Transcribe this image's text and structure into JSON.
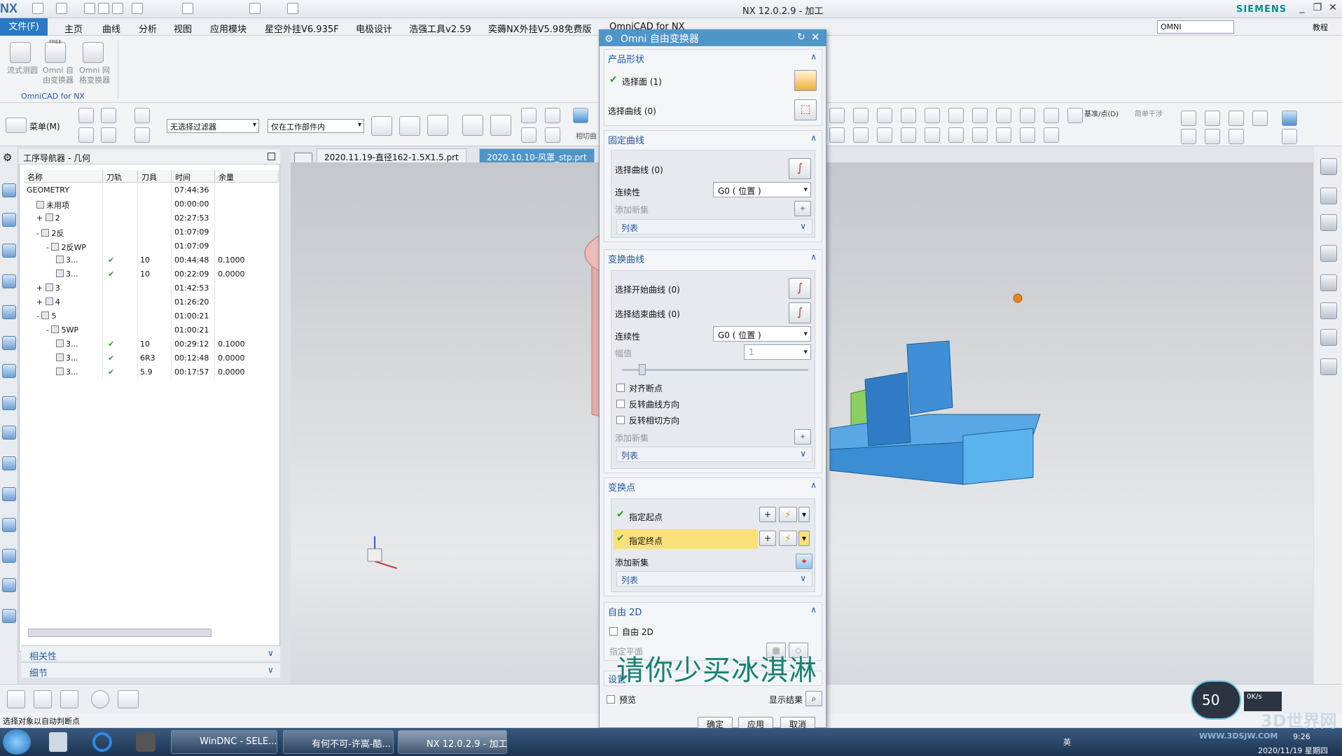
{
  "window": {
    "title": "NX 12.0.2.9 - 加工",
    "brand": "SIEMENS",
    "logo": "NX"
  },
  "menu": {
    "file": "文件(F)",
    "items": [
      "主页",
      "曲线",
      "分析",
      "视图",
      "应用模块",
      "星空外挂V6.935F",
      "电极设计",
      "浩强工具v2.59",
      "奕薅NX外挂V5.98免费版",
      "OmniCAD for NX"
    ],
    "search_value": "OMNI",
    "help": "教程"
  },
  "ribbon": {
    "tools": [
      "流式测圆",
      "Omni 自由变换器",
      "Omni 网格变换器"
    ],
    "free_badge": "FREE",
    "group_label": "OmniCAD for NX"
  },
  "toolbar": {
    "menu_label": "菜单(M)",
    "filter": "无选择过滤器",
    "scope": "仅在工作部件内",
    "partial": "相切曲",
    "datum": "基准/点(D)",
    "simple": "简单干涉"
  },
  "navigator": {
    "title": "工序导航器 - 几何",
    "columns": [
      "名称",
      "刀轨",
      "刀具",
      "时间",
      "余量"
    ],
    "rows": [
      {
        "name": "GEOMETRY",
        "path": "",
        "tool": "",
        "time": "07:44:36",
        "stock": "",
        "indent": 0,
        "toggle": ""
      },
      {
        "name": "未用项",
        "path": "",
        "tool": "",
        "time": "00:00:00",
        "stock": "",
        "indent": 1,
        "toggle": ""
      },
      {
        "name": "2",
        "path": "",
        "tool": "",
        "time": "02:27:53",
        "stock": "",
        "indent": 1,
        "toggle": "+"
      },
      {
        "name": "2反",
        "path": "",
        "tool": "",
        "time": "01:07:09",
        "stock": "",
        "indent": 1,
        "toggle": "-"
      },
      {
        "name": "2反WP",
        "path": "",
        "tool": "",
        "time": "01:07:09",
        "stock": "",
        "indent": 2,
        "toggle": "-"
      },
      {
        "name": "3...",
        "path": "✔",
        "tool": "10",
        "time": "00:44:48",
        "stock": "0.1000",
        "indent": 3,
        "toggle": ""
      },
      {
        "name": "3...",
        "path": "✔",
        "tool": "10",
        "time": "00:22:09",
        "stock": "0.0000",
        "indent": 3,
        "toggle": ""
      },
      {
        "name": "3",
        "path": "",
        "tool": "",
        "time": "01:42:53",
        "stock": "",
        "indent": 1,
        "toggle": "+"
      },
      {
        "name": "4",
        "path": "",
        "tool": "",
        "time": "01:26:20",
        "stock": "",
        "indent": 1,
        "toggle": "+"
      },
      {
        "name": "5",
        "path": "",
        "tool": "",
        "time": "01:00:21",
        "stock": "",
        "indent": 1,
        "toggle": "-"
      },
      {
        "name": "5WP",
        "path": "",
        "tool": "",
        "time": "01:00:21",
        "stock": "",
        "indent": 2,
        "toggle": "-"
      },
      {
        "name": "3...",
        "path": "✔",
        "tool": "10",
        "time": "00:29:12",
        "stock": "0.1000",
        "indent": 3,
        "toggle": ""
      },
      {
        "name": "3...",
        "path": "✔",
        "tool": "6R3",
        "time": "00:12:48",
        "stock": "0.0000",
        "indent": 3,
        "toggle": ""
      },
      {
        "name": "3...",
        "path": "✔",
        "tool": "5.9",
        "time": "00:17:57",
        "stock": "0.0000",
        "indent": 3,
        "toggle": ""
      }
    ],
    "footer": [
      "相关性",
      "细节"
    ]
  },
  "tabs": [
    "2020.11.19-直径162-1.5X1.5.prt",
    "2020.10.10-风罩_stp.prt"
  ],
  "dialog": {
    "title": "Omni 自由变换器",
    "product_shape": {
      "header": "产品形状",
      "select_face": "选择面 (1)",
      "select_curve": "选择曲线 (0)"
    },
    "fixed_curve": {
      "header": "固定曲线",
      "select_curve": "选择曲线 (0)",
      "continuity_label": "连续性",
      "continuity_value": "G0 ( 位置 )",
      "add_set": "添加新集",
      "list": "列表"
    },
    "transform_curve": {
      "header": "变换曲线",
      "start": "选择开始曲线 (0)",
      "end": "选择结束曲线 (0)",
      "continuity_label": "连续性",
      "continuity_value": "G0 ( 位置 )",
      "amplitude_label": "幅值",
      "amplitude_value": "1",
      "align": "对齐断点",
      "reverse_curve": "反转曲线方向",
      "reverse_tangent": "反转相切方向",
      "add_set": "添加新集",
      "list": "列表"
    },
    "transform_point": {
      "header": "变换点",
      "start": "指定起点",
      "end": "指定终点",
      "add_set": "添加新集",
      "list": "列表"
    },
    "free2d": {
      "header": "自由 2D",
      "checkbox": "自由 2D",
      "plane": "指定平面"
    },
    "settings": {
      "header": "设置"
    },
    "preview": "预览",
    "show_result": "显示结果",
    "ok": "确定",
    "apply": "应用",
    "cancel": "取消"
  },
  "overlay_text": "请你少买冰淇淋",
  "status": "选择对象以自动判断点",
  "taskbar": {
    "apps": [
      "WinDNC - SELE...",
      "有何不可-许嵩-酷...",
      "NX 12.0.2.9 - 加工"
    ],
    "ime": "英",
    "time": "9:26",
    "date": "2020/11/19 星期四",
    "net_badge": "50",
    "net_speed": "0K/s",
    "watermark": "3D世界网",
    "watermark_url": "WWW.3DSJW.COM"
  }
}
